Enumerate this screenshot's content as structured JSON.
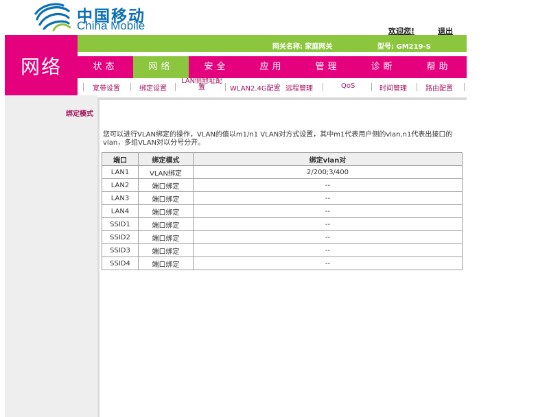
{
  "brand": {
    "name_cn": "中国移动",
    "name_en": "China Mobile",
    "color_blue": "#0a6fb4",
    "color_magenta": "#e5007e",
    "color_green": "#8cc63f"
  },
  "top_links": {
    "welcome": "欢迎您!",
    "logout": "退出"
  },
  "header": {
    "section_title": "网络",
    "gateway_name": "网关名称: 家庭网关",
    "model": "型号: GM219-S"
  },
  "main_nav": {
    "tabs": [
      {
        "label": "状态",
        "active": false
      },
      {
        "label": "网络",
        "active": true
      },
      {
        "label": "安全",
        "active": false
      },
      {
        "label": "应用",
        "active": false
      },
      {
        "label": "管理",
        "active": false
      },
      {
        "label": "诊断",
        "active": false
      },
      {
        "label": "帮助",
        "active": false
      }
    ]
  },
  "sub_nav": {
    "items": [
      {
        "label": "宽带设置"
      },
      {
        "label": "绑定设置"
      },
      {
        "label_line1": "LAN侧地址配",
        "label_line2": "置"
      },
      {
        "label": "WLAN2.4G配置"
      },
      {
        "label": "远程管理"
      },
      {
        "label": "QoS"
      },
      {
        "label": "时间管理"
      },
      {
        "label": "路由配置"
      }
    ]
  },
  "sidebar": {
    "label": "绑定模式"
  },
  "main": {
    "description": "您可以进行VLAN绑定的操作，VLAN的值以m1/n1 VLAN对方式设置，其中m1代表用户侧的vlan,n1代表出接口的vlan，多组VLAN对以分号分开。",
    "table": {
      "headers": [
        "端口",
        "绑定模式",
        "绑定vlan对"
      ],
      "rows": [
        [
          "LAN1",
          "VLAN绑定",
          "2/200;3/400"
        ],
        [
          "LAN2",
          "端口绑定",
          "--"
        ],
        [
          "LAN3",
          "端口绑定",
          "--"
        ],
        [
          "LAN4",
          "端口绑定",
          "--"
        ],
        [
          "SSID1",
          "端口绑定",
          "--"
        ],
        [
          "SSID2",
          "端口绑定",
          "--"
        ],
        [
          "SSID3",
          "端口绑定",
          "--"
        ],
        [
          "SSID4",
          "端口绑定",
          "--"
        ]
      ]
    }
  }
}
